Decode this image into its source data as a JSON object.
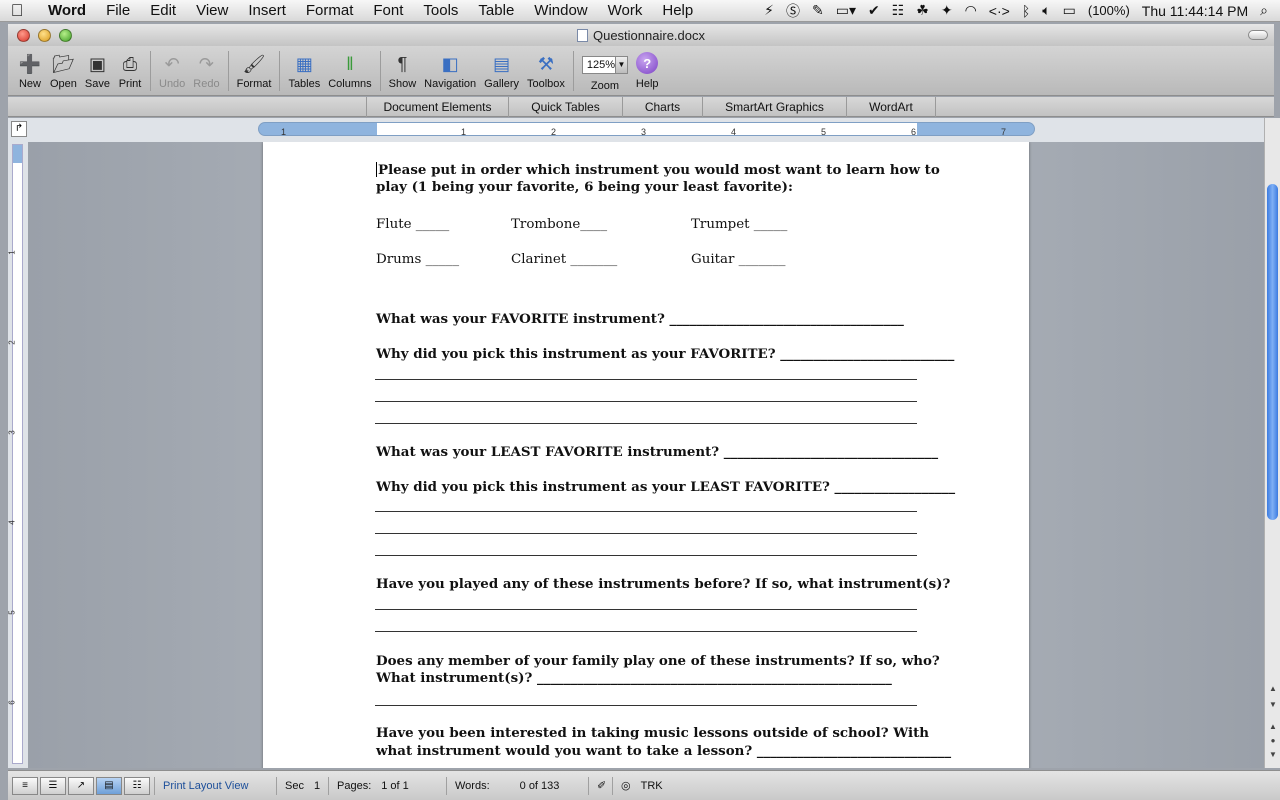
{
  "menubar": {
    "apple": "",
    "app": "Word",
    "items": [
      "File",
      "Edit",
      "View",
      "Insert",
      "Format",
      "Font",
      "Tools",
      "Table",
      "Window",
      "Work",
      "Help"
    ],
    "battery": "(100%)",
    "clock": "Thu 11:44:14 PM"
  },
  "window": {
    "title": "Questionnaire.docx"
  },
  "toolbar": {
    "new": "New",
    "open": "Open",
    "save": "Save",
    "print": "Print",
    "undo": "Undo",
    "redo": "Redo",
    "format": "Format",
    "tables": "Tables",
    "columns": "Columns",
    "show": "Show",
    "navigation": "Navigation",
    "gallery": "Gallery",
    "toolbox": "Toolbox",
    "zoom_value": "125%",
    "zoom": "Zoom",
    "help": "Help"
  },
  "ribbon": {
    "tabs": [
      "Document Elements",
      "Quick Tables",
      "Charts",
      "SmartArt Graphics",
      "WordArt"
    ]
  },
  "ruler": {
    "marks": [
      "1",
      "1",
      "2",
      "3",
      "4",
      "5",
      "6",
      "7"
    ]
  },
  "vruler": {
    "marks": [
      "1",
      "2",
      "3",
      "4",
      "5",
      "6"
    ]
  },
  "document": {
    "q1_line1": "Please put in order which instrument you would most want to learn how to",
    "q1_line2": "play (1 being your favorite, 6 being your least favorite):",
    "instruments": {
      "flute": "Flute _____",
      "trombone": "Trombone____",
      "trumpet": "Trumpet _____",
      "drums": "Drums _____",
      "clarinet": "Clarinet _______",
      "guitar": "Guitar _______"
    },
    "q2": "What was your FAVORITE instrument? ___________________________________",
    "q3": "Why did you pick this instrument as your FAVORITE? __________________________",
    "q4": "What was your LEAST FAVORITE instrument? ________________________________",
    "q5": "Why did you pick this instrument as your LEAST FAVORITE? __________________",
    "q6": "Have you played any of these instruments before? If so, what instrument(s)?",
    "q7_line1": "Does any member of your family play one of these instruments?  If so, who?",
    "q7_line2": "What instrument(s)? _____________________________________________________",
    "q8_line1": "Have you been interested in taking music lessons outside of school?  With",
    "q8_line2": "what instrument would you want to take a lesson? _____________________________"
  },
  "status": {
    "view": "Print Layout View",
    "sec_label": "Sec",
    "sec_value": "1",
    "pages_label": "Pages:",
    "pages_value": "1 of 1",
    "words_label": "Words:",
    "words_value": "0 of 133",
    "trk": "TRK"
  }
}
